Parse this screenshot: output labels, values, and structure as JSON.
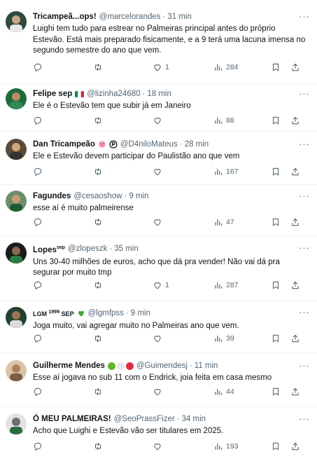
{
  "colors": {
    "accent_green": "#1a7f37",
    "muted": "#536471",
    "text": "#0f1419",
    "divider": "#eff3f4"
  },
  "icons": [
    "reply-icon",
    "retweet-icon",
    "like-icon",
    "views-icon",
    "bookmark-icon",
    "share-icon",
    "more-icon"
  ],
  "tweets": [
    {
      "name": "Tricampeã...ops!",
      "handle": "@marcelorandes",
      "time": "31 min",
      "text": "Luighi tem tudo para estrear no Palmeiras principal antes do próprio Estevão. Está mais preparado fisicamente, e a 9 terá uma lacuna imensa no segundo semestre do ano que vem.",
      "replies": "",
      "retweets": "",
      "likes": "1",
      "views": "284"
    },
    {
      "name": "Felipe sep",
      "handle": "@lizinha24680",
      "time": "18 min",
      "text": "Ele é o Estevão tem que subir já em Janeiro",
      "replies": "",
      "retweets": "",
      "likes": "",
      "views": "88"
    },
    {
      "name": "Dan Tricampeão",
      "handle": "@D4niloMateus",
      "time": "28 min",
      "text": "Ele e Estevão devem participar do Paulistão ano que vem",
      "replies": "",
      "retweets": "",
      "likes": "",
      "views": "167"
    },
    {
      "name": "Fagundes",
      "handle": "@cesaoshow",
      "time": "9 min",
      "text": "esse aí é muito palmeirense",
      "replies": "",
      "retweets": "",
      "likes": "",
      "views": "47"
    },
    {
      "name": "Lopes",
      "name_sup": "sep",
      "handle": "@zlopeszk",
      "time": "35 min",
      "text": "Uns 30-40 milhões de euros, acho que dá pra vender! Não vai dá pra segurar por muito tmp",
      "replies": "",
      "retweets": "",
      "likes": "1",
      "views": "287"
    },
    {
      "name": "LGM",
      "name_sup": "1999",
      "name_suffix": "SEP",
      "handle": "@lgmfpss",
      "time": "9 min",
      "text": "Joga muito, vai agregar muito no Palmeiras ano que vem.",
      "replies": "",
      "retweets": "",
      "likes": "",
      "views": "39"
    },
    {
      "name": "Guilherme Mendes",
      "handle": "@Guimendesj",
      "time": "11 min",
      "text": "Esse aí jogava no sub 11 com o Endrick, joia feita em casa mesmo",
      "replies": "",
      "retweets": "",
      "likes": "",
      "views": "44"
    },
    {
      "name": "Ó MEU PALMEIRAS!",
      "handle": "@SeoPrassFizer",
      "time": "34 min",
      "text": "Acho que Luighi e Estevão vão ser titulares em 2025.",
      "replies": "",
      "retweets": "",
      "likes": "",
      "views": "193"
    }
  ]
}
